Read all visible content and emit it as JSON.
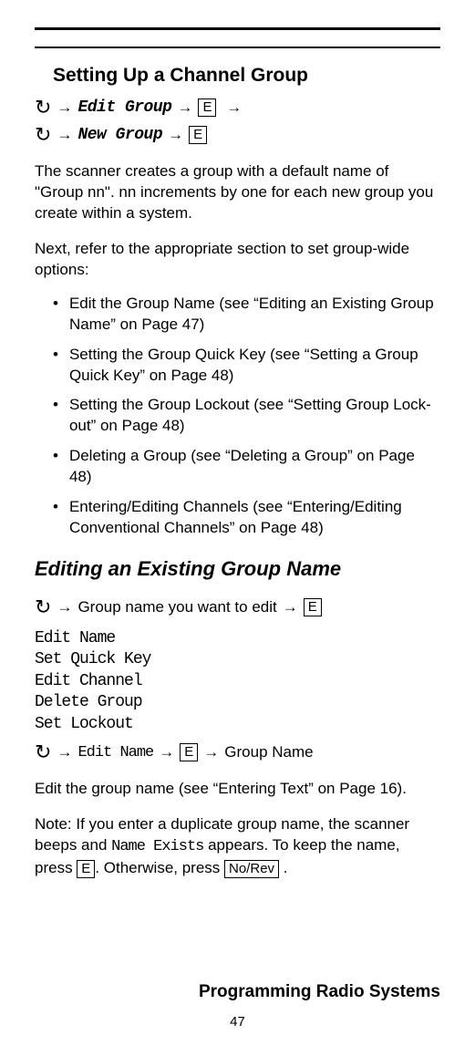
{
  "section_title": "Setting Up a Channel Group",
  "nav1": {
    "item1": "Edit Group",
    "key1": "E"
  },
  "nav2": {
    "item1": "New Group",
    "key1": "E"
  },
  "para1": "The scanner creates a group with a default name of \"Group nn\". nn increments by one for each new group you create within a system.",
  "para2": "Next, refer to the appropriate section to set group-wide options:",
  "bullets": [
    "Edit the Group Name (see “Editing an Existing Group Name” on Page 47)",
    "Setting the Group Quick Key (see “Setting a Group Quick Key” on Page 48)",
    "Setting the Group Lockout (see “Setting Group Lock-out” on Page 48)",
    "Deleting a Group (see “Deleting a Group” on Page 48)",
    "Entering/Editing Channels (see “Entering/Editing Conventional Channels” on Page 48)"
  ],
  "subsection_title": "Editing an Existing Group Name",
  "nav3": {
    "text1": "Group name you want to edit",
    "key1": "E"
  },
  "menu": [
    "Edit Name",
    "Set Quick Key",
    "Edit Channel",
    "Delete Group",
    "Set Lockout"
  ],
  "nav4": {
    "item1": "Edit Name",
    "key1": "E",
    "text2": "Group Name"
  },
  "para3": "Edit the group name (see “Entering Text” on Page 16).",
  "note": {
    "prefix": "Note: If you enter a duplicate group name, the scanner beeps and ",
    "scanner_text": "Name Exists",
    "middle": " appears. To keep the name, press ",
    "key1": "E",
    "middle2": ". Otherwise, press ",
    "key2": "No/Rev",
    "suffix": " ."
  },
  "footer": "Programming Radio Systems",
  "page_number": "47"
}
